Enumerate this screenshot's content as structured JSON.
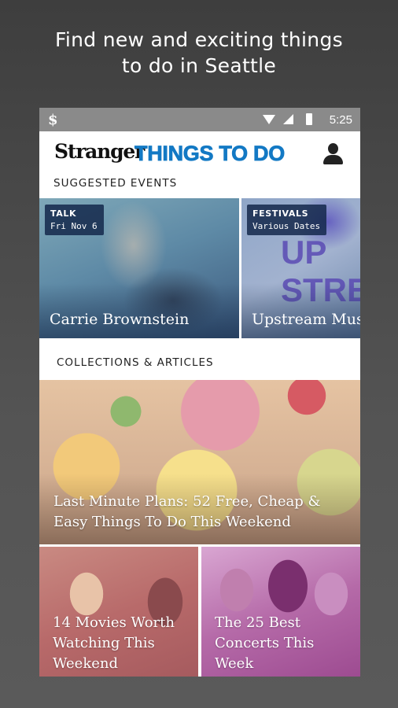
{
  "headline": {
    "line1": "Find new and exciting things",
    "line2": "to do in Seattle"
  },
  "status_bar": {
    "app_icon": "$",
    "time": "5:25",
    "icons": [
      "wifi-icon",
      "signal-icon",
      "battery-icon"
    ]
  },
  "app_bar": {
    "brand": "Stranger",
    "title": "THINGS TO DO",
    "title_color": "#1379c4",
    "profile_icon": "user-icon"
  },
  "suggested": {
    "heading": "SUGGESTED EVENTS",
    "events": [
      {
        "category": "TALK",
        "date": "Fri Nov 6",
        "title": "Carrie Brownstein"
      },
      {
        "category": "FESTIVALS",
        "date": "Various Dates",
        "title": "Upstream Music Summit",
        "art_text": "UP STREAM"
      }
    ]
  },
  "collections": {
    "heading": "COLLECTIONS & ARTICLES",
    "items": [
      {
        "title": "Last Minute Plans: 52 Free, Cheap & Easy Things To Do This Weekend"
      },
      {
        "title": "14 Movies Worth Watching This Weekend"
      },
      {
        "title": "The 25 Best Concerts This Week"
      }
    ]
  }
}
